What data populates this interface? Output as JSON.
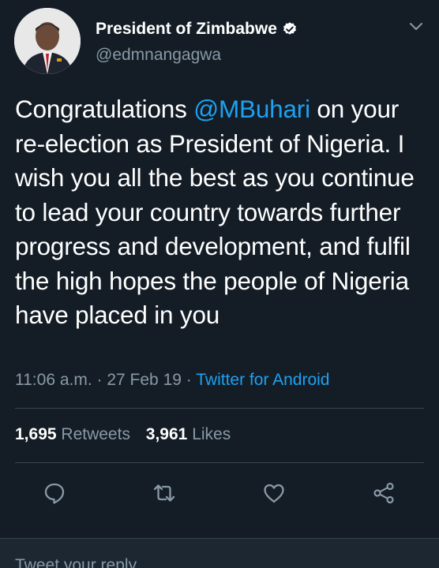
{
  "tweet": {
    "author_name": "President of Zimbabwe",
    "handle": "@edmnangagwa",
    "text_before": "Congratulations ",
    "mention": "@MBuhari",
    "text_after": " on your re-election as President of Nigeria. I wish you all the best as you continue to lead your country towards further progress and development, and fulfil the high hopes the people of Nigeria have placed in you",
    "time": "11:06 a.m.",
    "separator": "·",
    "date": "27 Feb 19",
    "source": "Twitter for Android"
  },
  "stats": {
    "retweets_count": "1,695",
    "retweets_label": "Retweets",
    "likes_count": "3,961",
    "likes_label": "Likes"
  },
  "reply": {
    "placeholder": "Tweet your reply"
  },
  "icons": {
    "verified": "verified-badge-icon",
    "caret": "chevron-down-icon",
    "reply": "reply-icon",
    "retweet": "retweet-icon",
    "like": "heart-icon",
    "share": "share-icon"
  },
  "colors": {
    "background": "#141d26",
    "link": "#1da1f2",
    "muted": "#8899a6",
    "divider": "#38444d"
  }
}
